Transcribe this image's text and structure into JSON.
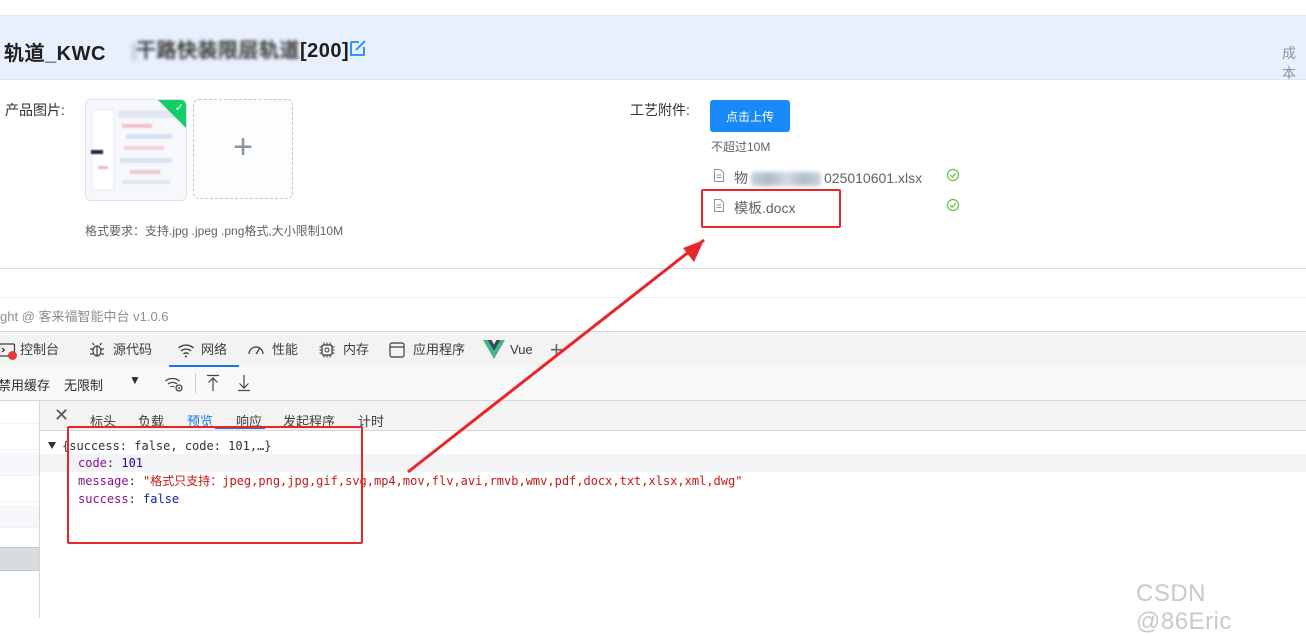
{
  "header": {
    "title_prefix": "轨道_KWC",
    "title_middle": "干路快装限层轨道",
    "title_suffix": "[200]",
    "right_label": "成本"
  },
  "product_images": {
    "label": "产品图片:",
    "format_hint": "格式要求：支持.jpg .jpeg .png格式,大小限制10M"
  },
  "process_attachments": {
    "label": "工艺附件:",
    "upload_button": "点击上传",
    "size_tip": "不超过10M",
    "files": [
      {
        "name": "物料清单2025010601.xlsx",
        "visible_prefix": "物",
        "visible_suffix": "025010601.xlsx"
      },
      {
        "name": "模板.docx"
      }
    ]
  },
  "footer": {
    "copyright": "ght @ 客来福智能中台 v1.0.6"
  },
  "devtools": {
    "tabs": [
      {
        "label": "控制台",
        "icon": "console-icon"
      },
      {
        "label": "源代码",
        "icon": "bug-icon"
      },
      {
        "label": "网络",
        "icon": "wifi-icon",
        "active": true
      },
      {
        "label": "性能",
        "icon": "gauge-icon"
      },
      {
        "label": "内存",
        "icon": "chip-icon"
      },
      {
        "label": "应用程序",
        "icon": "app-icon"
      },
      {
        "label": "Vue",
        "icon": "vue-icon"
      }
    ],
    "toolbar": {
      "disable_cache": "禁用缓存",
      "throttle": "无限制"
    },
    "detail_tabs": [
      "标头",
      "负载",
      "预览",
      "响应",
      "发起程序",
      "计时"
    ],
    "active_detail_tab": "预览",
    "preview": {
      "summary": "{success: false, code: 101,…}",
      "code_key": "code",
      "code_value": "101",
      "message_key": "message",
      "message_value": "\"格式只支持：jpeg,png,jpg,gif,svg,mp4,mov,flv,avi,rmvb,wmv,pdf,docx,txt,xlsx,xml,dwg\"",
      "success_key": "success",
      "success_value": "false"
    }
  },
  "watermark": "CSDN @86Eric",
  "colors": {
    "primary": "#1989fa",
    "success": "#13ce66",
    "annotation_red": "#e8262a",
    "devtools_accent": "#1a73e8"
  }
}
